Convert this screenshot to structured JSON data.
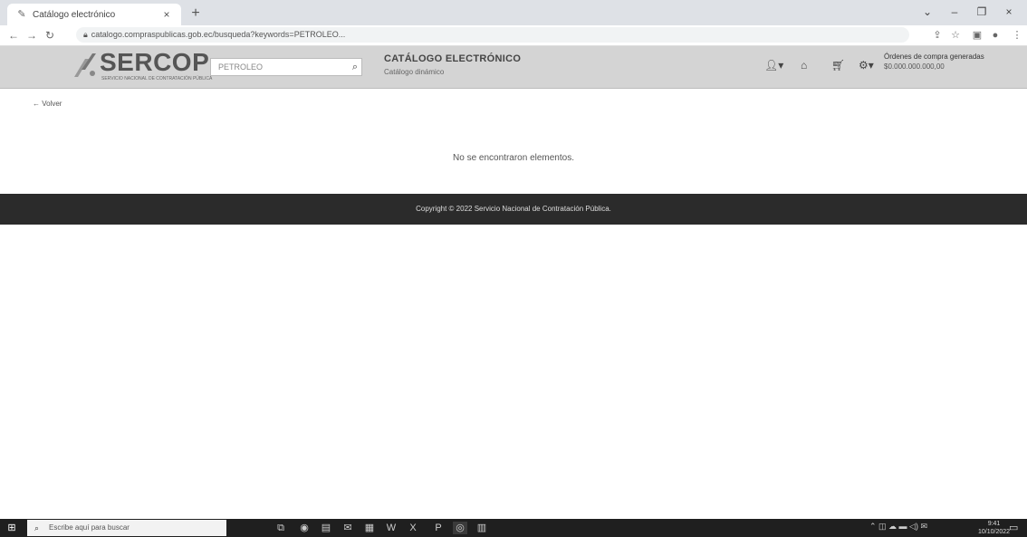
{
  "browser": {
    "tab_title": "Catálogo electrónico",
    "tab_close": "×",
    "new_tab": "+",
    "url": "catalogo.compraspublicas.gob.ec/busqueda?keywords=PETROLEO...",
    "window_controls": [
      "⌄",
      "–",
      "❐",
      "×"
    ]
  },
  "header": {
    "logo_text": "SERCOP",
    "logo_tagline": "SERVICIO NACIONAL DE CONTRATACIÓN PÚBLICA",
    "search_placeholder": "PETROLEO",
    "catalog_title": "CATÁLOGO ELECTRÓNICO",
    "catalog_subtitle": "Catálogo dinámico",
    "orders_line1": "Órdenes de compra generadas",
    "orders_line2": "$0.000.000.000,00"
  },
  "main": {
    "back_label": "← Volver",
    "no_results": "No se encontraron elementos."
  },
  "footer": {
    "copyright": "Copyright © 2022 Servicio Nacional de Contratación Pública."
  },
  "taskbar": {
    "search_placeholder": "Escribe aquí para buscar",
    "clock_time": "9:41",
    "clock_date": "10/10/2022"
  }
}
